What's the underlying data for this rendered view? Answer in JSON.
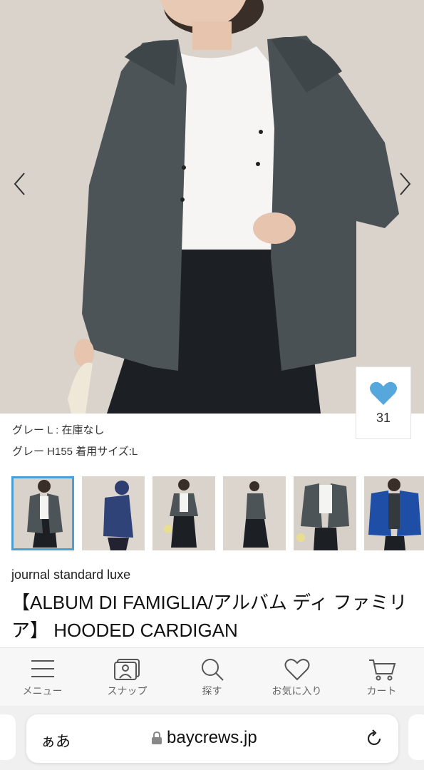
{
  "like": {
    "count": "31"
  },
  "variants": [
    "グレー L : 在庫なし",
    "グレー H155 着用サイズ:L"
  ],
  "brand": "journal standard luxe",
  "title": "【ALBUM DI FAMIGLIA/アルバム ディ ファミリア】 HOODED CARDIGAN",
  "tabs": [
    {
      "label": "メニュー",
      "icon": "menu-icon"
    },
    {
      "label": "スナップ",
      "icon": "snap-icon"
    },
    {
      "label": "探す",
      "icon": "search-icon"
    },
    {
      "label": "お気に入り",
      "icon": "heart-icon"
    },
    {
      "label": "カート",
      "icon": "cart-icon"
    }
  ],
  "browser": {
    "text_size": "ぁあ",
    "domain": "baycrews.jp"
  },
  "colors": {
    "accent": "#4a9fd6",
    "heart": "#55a7dc"
  }
}
